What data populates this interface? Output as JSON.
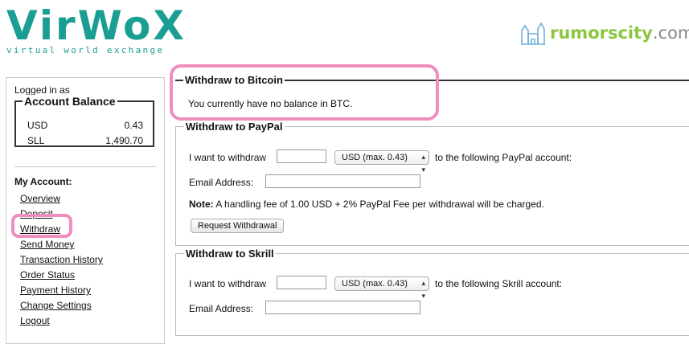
{
  "brand": {
    "logo_text": "VirWoX",
    "logo_tagline": "virtual world exchange",
    "watermark": "rumorscity",
    "watermark_tld": ".com"
  },
  "sidebar": {
    "logged_in": "Logged in as",
    "balance_title": "Account Balance",
    "balances": [
      {
        "currency": "USD",
        "amount": "0.43"
      },
      {
        "currency": "SLL",
        "amount": "1,490.70"
      }
    ],
    "my_account": "My Account:",
    "menu": [
      "Overview",
      "Deposit",
      "Withdraw",
      "Send Money",
      "Transaction History",
      "Order Status",
      "Payment History",
      "Change Settings",
      "Logout"
    ]
  },
  "bitcoin": {
    "title": "Withdraw to Bitcoin",
    "message": "You currently have no balance in BTC."
  },
  "paypal": {
    "title": "Withdraw to PayPal",
    "want_label": "I want to withdraw",
    "currency_option": "USD (max. 0.43)",
    "to_label": "to the following PayPal account:",
    "email_label": "Email Address:",
    "note_label": "Note:",
    "note_text": "A handling fee of 1.00 USD + 2% PayPal Fee per withdrawal will be charged.",
    "button": "Request Withdrawal"
  },
  "skrill": {
    "title": "Withdraw to Skrill",
    "want_label": "I want to withdraw",
    "currency_option": "USD (max. 0.43)",
    "to_label": "to the following Skrill account:",
    "email_label": "Email Address:"
  },
  "colors": {
    "brand_teal": "#1a9e93",
    "highlight_pink": "#ee8fbf",
    "watermark_green": "#8cc63f"
  }
}
